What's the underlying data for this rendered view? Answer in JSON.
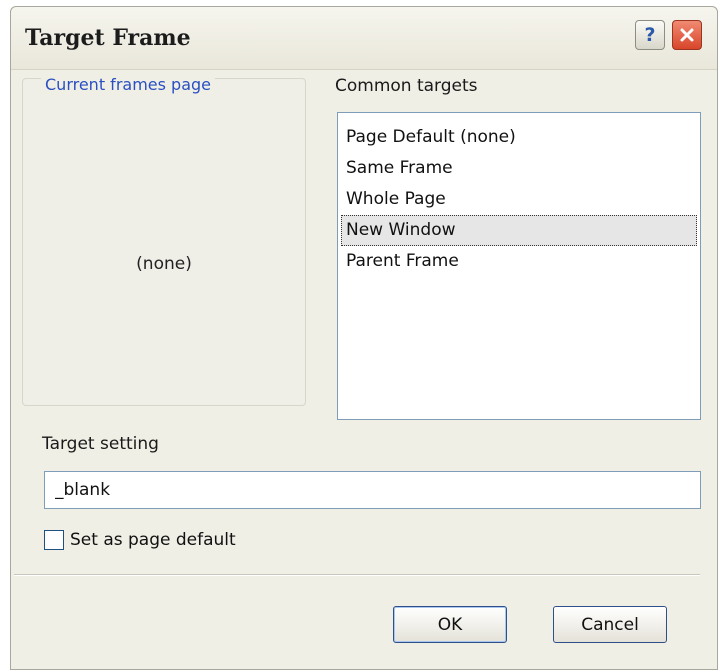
{
  "window": {
    "title": "Target Frame",
    "help_label": "?"
  },
  "frames_group": {
    "legend": "Current frames page",
    "placeholder": "(none)"
  },
  "common_targets": {
    "label": "Common targets",
    "items": [
      {
        "label": "Page Default (none)",
        "selected": false
      },
      {
        "label": "Same Frame",
        "selected": false
      },
      {
        "label": "Whole Page",
        "selected": false
      },
      {
        "label": "New Window",
        "selected": true
      },
      {
        "label": "Parent Frame",
        "selected": false
      }
    ]
  },
  "target_setting": {
    "label": "Target setting",
    "value": "_blank"
  },
  "page_default": {
    "label": "Set as page default",
    "checked": false
  },
  "buttons": {
    "ok": "OK",
    "cancel": "Cancel"
  },
  "colors": {
    "legend_text": "#2b4fc2",
    "close_button": "#d8452a",
    "dialog_background": "#f0efe6"
  }
}
